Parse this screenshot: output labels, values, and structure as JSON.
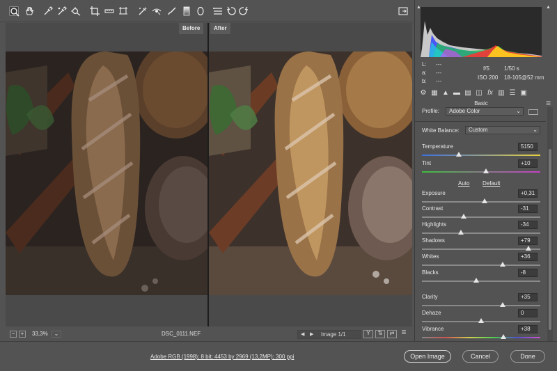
{
  "toolbar": {
    "tools": [
      "zoom-tool-icon",
      "hand-tool-icon",
      "white-balance-tool-icon",
      "color-sampler-tool-icon",
      "targeted-adjustment-tool-icon",
      "crop-tool-icon",
      "straighten-tool-icon",
      "transform-tool-icon",
      "spot-removal-tool-icon",
      "red-eye-removal-tool-icon",
      "adjustment-brush-icon",
      "graduated-filter-icon",
      "radial-filter-icon",
      "open-preferences-icon",
      "rotate-left-icon",
      "rotate-right-icon"
    ]
  },
  "preview": {
    "before_label": "Before",
    "after_label": "After"
  },
  "preview_bar": {
    "zoom": "33,3%",
    "filename": "DSC_0111.NEF",
    "image_counter": "Image 1/1"
  },
  "histogram": {
    "l_label": "L:",
    "a_label": "a:",
    "b_label": "b:",
    "l_value": "---",
    "a_value": "---",
    "b_value": "---",
    "aperture": "f/5",
    "shutter": "1/50 s",
    "iso": "ISO 200",
    "lens": "18-105@52 mm"
  },
  "basic": {
    "section_title": "Basic",
    "profile_label": "Profile:",
    "profile_value": "Adobe Color",
    "white_balance_label": "White Balance:",
    "white_balance_value": "Custom",
    "auto_label": "Auto",
    "default_label": "Default",
    "sliders": [
      {
        "label": "Temperature",
        "value": "5150",
        "position": 0.31
      },
      {
        "label": "Tint",
        "value": "+10",
        "position": 0.54
      },
      {
        "label": "Exposure",
        "value": "+0,31",
        "position": 0.53
      },
      {
        "label": "Contrast",
        "value": "-31",
        "position": 0.35
      },
      {
        "label": "Highlights",
        "value": "-34",
        "position": 0.33
      },
      {
        "label": "Shadows",
        "value": "+79",
        "position": 0.9
      },
      {
        "label": "Whites",
        "value": "+36",
        "position": 0.68
      },
      {
        "label": "Blacks",
        "value": "-8",
        "position": 0.46
      },
      {
        "label": "Clarity",
        "value": "+35",
        "position": 0.68
      },
      {
        "label": "Dehaze",
        "value": "0",
        "position": 0.5
      },
      {
        "label": "Vibrance",
        "value": "+38",
        "position": 0.69
      }
    ]
  },
  "footer": {
    "workflow_info": "Adobe RGB (1998); 8 bit; 4453 by 2969 (13,2MP); 300 ppi",
    "open_image_label": "Open Image",
    "cancel_label": "Cancel",
    "done_label": "Done"
  },
  "colors": {
    "panel_bg": "#535353",
    "track_temperature": [
      "#3c6fe0",
      "#e8d23c"
    ],
    "track_tint": [
      "#3fbf3f",
      "#c63fc6"
    ]
  }
}
